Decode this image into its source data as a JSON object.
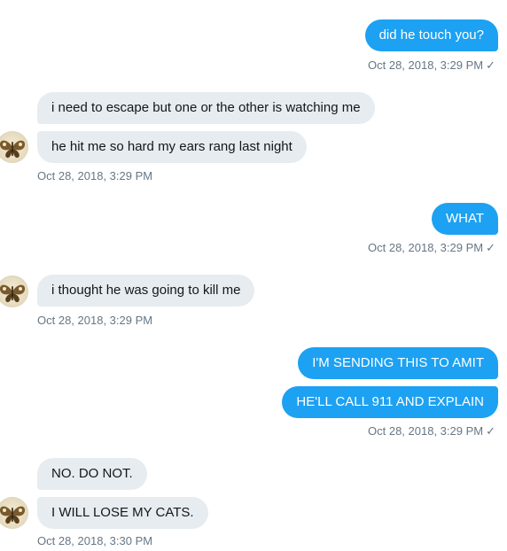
{
  "messages": {
    "m1": "did he touch you?",
    "m2": "i need to escape but one or the other is watching me",
    "m3": "he hit me so hard my ears rang last night",
    "m4": "WHAT",
    "m5": "i thought he was going to kill me",
    "m6": "I'M SENDING THIS TO AMIT",
    "m7": "HE'LL CALL 911 AND EXPLAIN",
    "m8": "NO. DO NOT.",
    "m9": "I WILL LOSE MY CATS."
  },
  "timestamps": {
    "t1": "Oct 28, 2018, 3:29 PM",
    "t2": "Oct 28, 2018, 3:29 PM",
    "t3": "Oct 28, 2018, 3:29 PM",
    "t4": "Oct 28, 2018, 3:29 PM",
    "t5": "Oct 28, 2018, 3:29 PM",
    "t6": "Oct 28, 2018, 3:30 PM"
  },
  "read_receipt": "✓",
  "icons": {
    "avatar": "butterfly-avatar-icon",
    "read": "checkmark-icon"
  },
  "colors": {
    "outgoing_bubble": "#1da1f2",
    "incoming_bubble": "#e6ecf0",
    "timestamp": "#657786"
  }
}
